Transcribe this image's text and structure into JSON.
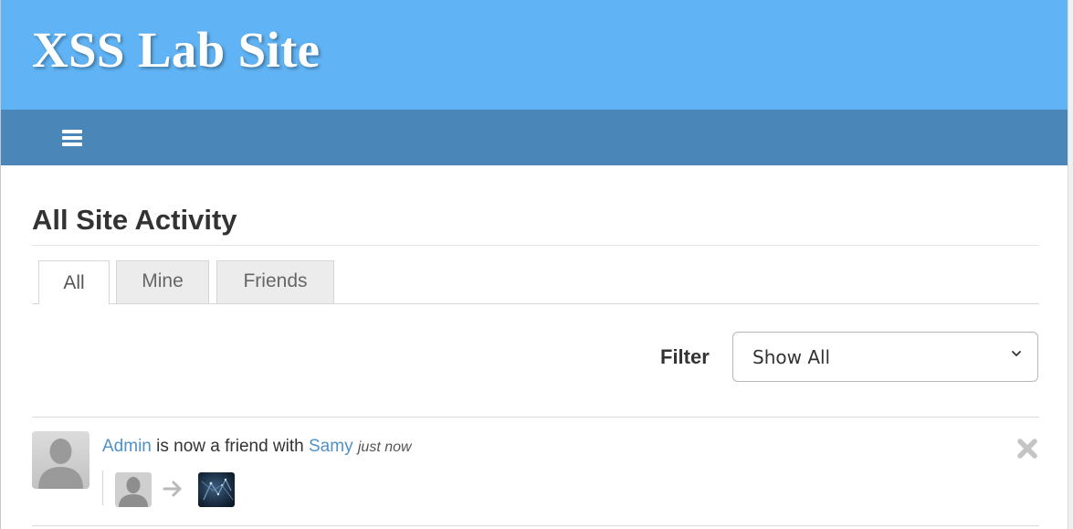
{
  "site": {
    "title": "XSS Lab Site"
  },
  "nav": {
    "menu_icon": "hamburger-menu-icon"
  },
  "page": {
    "title": "All Site Activity"
  },
  "tabs": [
    {
      "label": "All",
      "active": true
    },
    {
      "label": "Mine",
      "active": false
    },
    {
      "label": "Friends",
      "active": false
    }
  ],
  "filter": {
    "label": "Filter",
    "selected": "Show All"
  },
  "activity": [
    {
      "subject": "Admin",
      "action": " is now a friend with ",
      "object": "Samy",
      "time": "just now",
      "icons": [
        "default-avatar-icon",
        "arrow-right-icon",
        "user-photo-icon",
        "delete-icon"
      ]
    }
  ],
  "colors": {
    "header_bg": "#60b3f4",
    "nav_bg": "#4a87b8",
    "link": "#4f91c8",
    "text": "#333333"
  }
}
